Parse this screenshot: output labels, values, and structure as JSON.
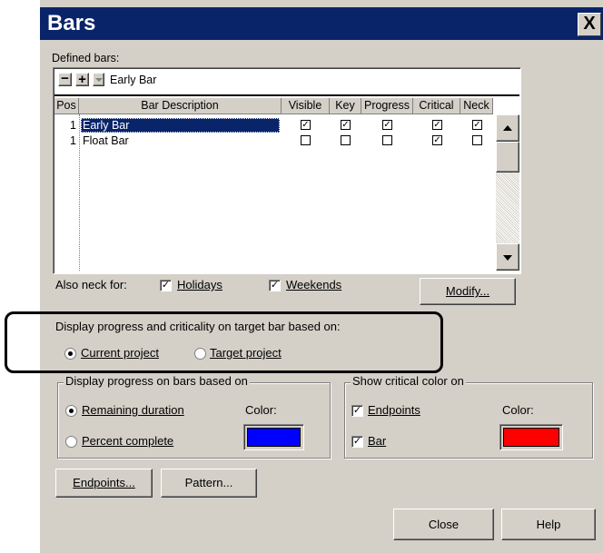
{
  "window": {
    "title": "Bars",
    "close_glyph": "X"
  },
  "defined_bars": {
    "label": "Defined bars:",
    "toolbar": {
      "remove": "−",
      "add": "+",
      "current": "Early Bar"
    },
    "columns": [
      "Pos",
      "Bar Description",
      "Visible",
      "Key",
      "Progress",
      "Critical",
      "Neck"
    ],
    "rows": [
      {
        "pos": "1",
        "desc": "Early Bar",
        "visible": "✓",
        "key": "✓",
        "progress": "✓",
        "critical": "✓",
        "neck": "✓"
      },
      {
        "pos": "1",
        "desc": "Float Bar",
        "visible": "",
        "key": "",
        "progress": "",
        "critical": "✓",
        "neck": ""
      }
    ]
  },
  "neck": {
    "label": "Also neck for:",
    "holidays": "Holidays",
    "weekends": "Weekends",
    "holidays_check": "✓",
    "weekends_check": "✓"
  },
  "modify_button": "Modify...",
  "target_section": {
    "label": "Display progress and criticality on target bar based on:",
    "current": "Current project",
    "target": "Target project"
  },
  "progress_group": {
    "legend": "Display progress on bars based on",
    "remaining": "Remaining duration",
    "percent": "Percent complete",
    "color_label": "Color:",
    "color": "#0000ff"
  },
  "critical_group": {
    "legend": "Show critical color on",
    "endpoints": "Endpoints",
    "bar": "Bar",
    "endpoints_check": "✓",
    "bar_check": "✓",
    "color_label": "Color:",
    "color": "#ff0000"
  },
  "buttons": {
    "endpoints": "Endpoints...",
    "pattern": "Pattern...",
    "close": "Close",
    "help": "Help"
  }
}
